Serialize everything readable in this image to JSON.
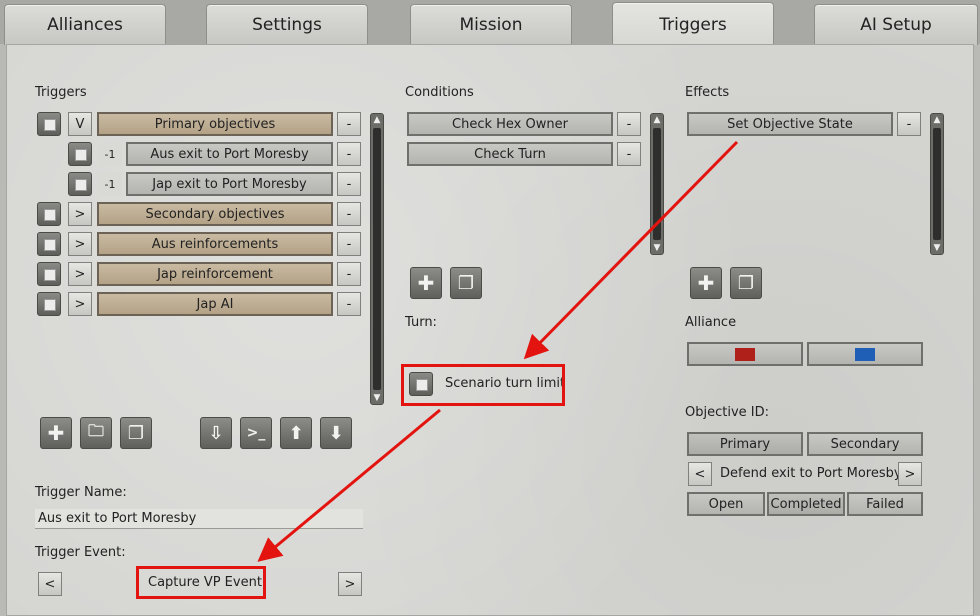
{
  "tabs": [
    "Alliances",
    "Settings",
    "Mission",
    "Triggers",
    "AI Setup"
  ],
  "triggers": {
    "heading": "Triggers",
    "rows": [
      {
        "toggle": "V",
        "label": "Primary objectives",
        "remove": "-"
      },
      {
        "num": "-1",
        "label": "Aus exit to Port Moresby",
        "remove": "-"
      },
      {
        "num": "-1",
        "label": "Jap exit to Port Moresby",
        "remove": "-"
      },
      {
        "toggle": ">",
        "label": "Secondary objectives",
        "remove": "-"
      },
      {
        "toggle": ">",
        "label": "Aus reinforcements",
        "remove": "-"
      },
      {
        "toggle": ">",
        "label": "Jap reinforcement",
        "remove": "-"
      },
      {
        "toggle": ">",
        "label": "Jap AI",
        "remove": "-"
      }
    ]
  },
  "conditions": {
    "heading": "Conditions",
    "rows": [
      {
        "label": "Check Hex Owner",
        "remove": "-"
      },
      {
        "label": "Check Turn",
        "remove": "-"
      }
    ]
  },
  "effects": {
    "heading": "Effects",
    "rows": [
      {
        "label": "Set Objective State",
        "remove": "-"
      }
    ]
  },
  "turn": {
    "heading": "Turn:",
    "checkbox_label": "Scenario turn limit"
  },
  "alliance": {
    "heading": "Alliance",
    "colors": [
      "#b0201a",
      "#1f5fb5"
    ]
  },
  "objective": {
    "heading": "Objective ID:",
    "types": [
      "Primary",
      "Secondary"
    ],
    "prev": "<",
    "value": "Defend exit to Port Moresby",
    "next": ">",
    "states": [
      "Open",
      "Completed",
      "Failed"
    ]
  },
  "trigger_name": {
    "heading": "Trigger Name:",
    "value": "Aus exit to Port Moresby"
  },
  "trigger_event": {
    "heading": "Trigger Event:",
    "prev": "<",
    "value": "Capture VP Event",
    "next": ">"
  },
  "scroll_glyphs": {
    "up": "▲",
    "down": "▼"
  },
  "icon_glyphs": {
    "add": "✚",
    "folder": "🗀",
    "copy": "❐",
    "import": "⇩",
    "console": ">_",
    "move_up": "⬆",
    "move_down": "⬇"
  },
  "annotation_color": "#e3140f"
}
